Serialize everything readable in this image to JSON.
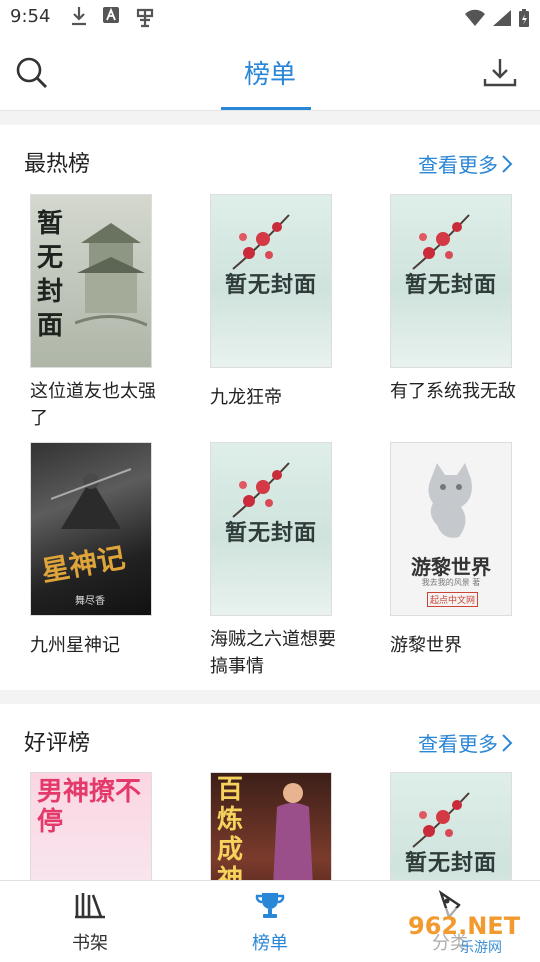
{
  "status_bar": {
    "time": "9:54"
  },
  "top_bar": {
    "active_tab": "榜单"
  },
  "sections": [
    {
      "title": "最热榜",
      "more_label": "查看更多",
      "books": [
        {
          "title": "这位道友也太强了",
          "cover": "vertical",
          "cover_text": "暂无封面"
        },
        {
          "title": "九龙狂帝",
          "cover": "placeholder",
          "cover_text": "暂无封面"
        },
        {
          "title": "有了系统我无敌",
          "cover": "placeholder",
          "cover_text": "暂无封面"
        },
        {
          "title": "九州星神记",
          "cover": "dark",
          "cover_text": "星神记",
          "cover_author": "舞尽香"
        },
        {
          "title": "海贼之六道想要搞事情",
          "cover": "placeholder",
          "cover_text": "暂无封面"
        },
        {
          "title": "游黎世界",
          "cover": "cat",
          "cover_text": "游黎世界",
          "cover_sub": "我去我的风景 著",
          "cover_badge": "起点中文网"
        }
      ]
    },
    {
      "title": "好评榜",
      "more_label": "查看更多",
      "books": [
        {
          "title": "",
          "cover": "pink",
          "cover_text": "男神撩不停"
        },
        {
          "title": "",
          "cover": "warm",
          "cover_text": "百炼成神"
        },
        {
          "title": "",
          "cover": "placeholder",
          "cover_text": "暂无封面"
        }
      ]
    }
  ],
  "bottom_nav": {
    "items": [
      {
        "label": "书架",
        "icon": "bookshelf-icon",
        "active": false
      },
      {
        "label": "榜单",
        "icon": "trophy-icon",
        "active": true
      },
      {
        "label": "分类",
        "icon": "category-icon",
        "active": false
      }
    ]
  },
  "watermark": {
    "brand": "962.NET",
    "sub": "乐游网"
  },
  "colors": {
    "accent": "#2a86d6",
    "text": "#222222",
    "divider": "#f3f3f3"
  }
}
